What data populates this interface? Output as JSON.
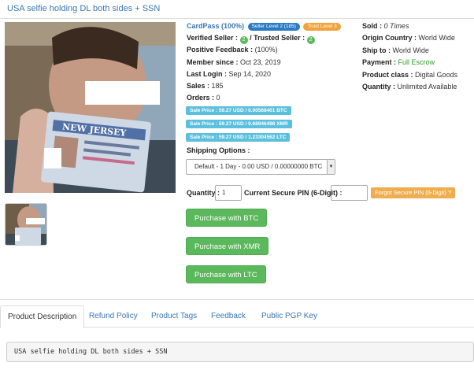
{
  "title": "USA selfie holding DL both sides + SSN",
  "photo": {
    "id_card_text": "NEW JERSEY"
  },
  "seller": {
    "name": "CardPass (100%)",
    "level_badge": "Seller Level 2 (185)",
    "trust_badge": "Trust Level 3",
    "verified_label": "Verified Seller :",
    "verified_check": "2",
    "trusted_label": "/ Trusted Seller :",
    "trusted_check": "2",
    "feedback_label": "Positive Feedback :",
    "feedback_value": "(100%)",
    "member_label": "Member since :",
    "member_value": "Oct 23, 2019",
    "login_label": "Last Login :",
    "login_value": "Sep 14, 2020",
    "sales_label": "Sales :",
    "sales_value": "185",
    "orders_label": "Orders :",
    "orders_value": "0"
  },
  "product": {
    "sold_label": "Sold :",
    "sold_value": "0 Times",
    "origin_label": "Origin Country :",
    "origin_value": "World Wide",
    "ship_label": "Ship to :",
    "ship_value": "World Wide",
    "payment_label": "Payment :",
    "payment_value": "Full Escrow",
    "class_label": "Product class :",
    "class_value": "Digital Goods",
    "quantity_label": "Quantity :",
    "quantity_value": "Unlimited Available"
  },
  "prices": {
    "btc": "Sale Price : 59.27 USD / 0.00568401 BTC",
    "xmr": "Sale Price : 59.27 USD / 0.68946498 XMR",
    "ltc": "Sale Price : 59.27 USD / 1.23304562 LTC"
  },
  "shipping": {
    "label": "Shipping Options :",
    "selected": "Default - 1 Day - 0.00 USD / 0.00000000 BTC"
  },
  "order_form": {
    "quantity_label": "Quantity :",
    "quantity_value": "1",
    "pin_label": "Current Secure PIN (6-Digit) :",
    "forgot_pin": "Forgot Secure PIN (6-Digit) ?"
  },
  "buttons": {
    "btc": "Purchase with BTC",
    "xmr": "Purchase with XMR",
    "ltc": "Purchase with LTC"
  },
  "tabs": [
    "Product Description",
    "Refund Policy",
    "Product Tags",
    "Feedback",
    "Public PGP Key"
  ],
  "description": "USA selfie holding DL both sides + SSN",
  "colors": {
    "link": "#3a76b6",
    "green_button": "#5cb85c",
    "price_badge": "#5bc0de",
    "orange": "#f0ad4e"
  }
}
